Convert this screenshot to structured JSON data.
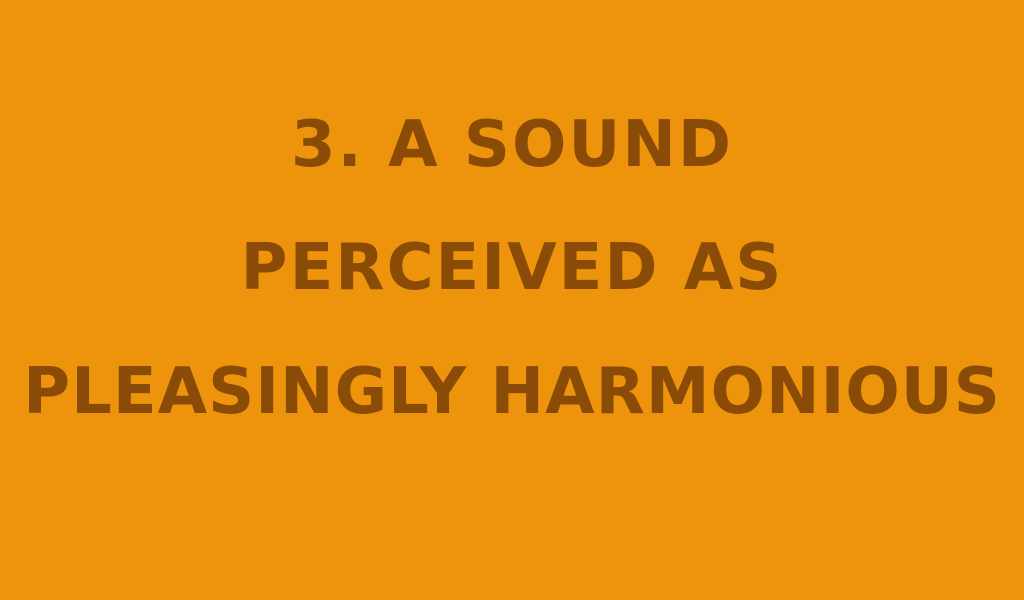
{
  "slide": {
    "lines": [
      "3. A SOUND",
      "PERCEIVED AS",
      "PLEASINGLY HARMONIOUS"
    ]
  },
  "colors": {
    "background": "#EE940C",
    "text": "#8A4B06"
  }
}
